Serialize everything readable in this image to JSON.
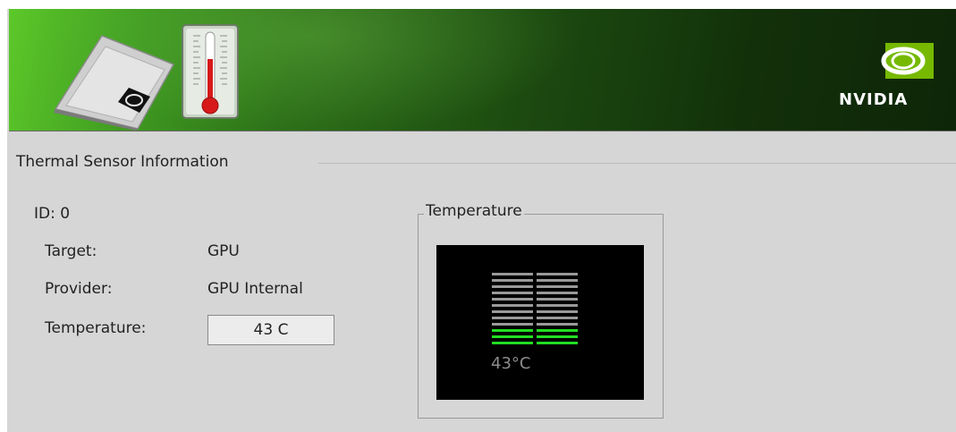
{
  "header": {
    "brand": "NVIDIA",
    "icons": [
      "chip-icon",
      "thermometer-icon",
      "nvidia-logo-icon"
    ]
  },
  "section": {
    "title": "Thermal Sensor Information"
  },
  "sensor": {
    "id_label": "ID: 0",
    "target_label": "Target:",
    "target_value": "GPU",
    "provider_label": "Provider:",
    "provider_value": "GPU Internal",
    "temperature_label": "Temperature:",
    "temperature_value": "43 C"
  },
  "gauge": {
    "group_title": "Temperature",
    "readout": "43°C",
    "total_segments": 12,
    "lit_segments": 3,
    "colors": {
      "lit": "#22dd22",
      "unlit": "#9a9a9a",
      "background": "#000000"
    }
  },
  "colors": {
    "panel": "#d6d6d6",
    "accent_green": "#76b900"
  }
}
